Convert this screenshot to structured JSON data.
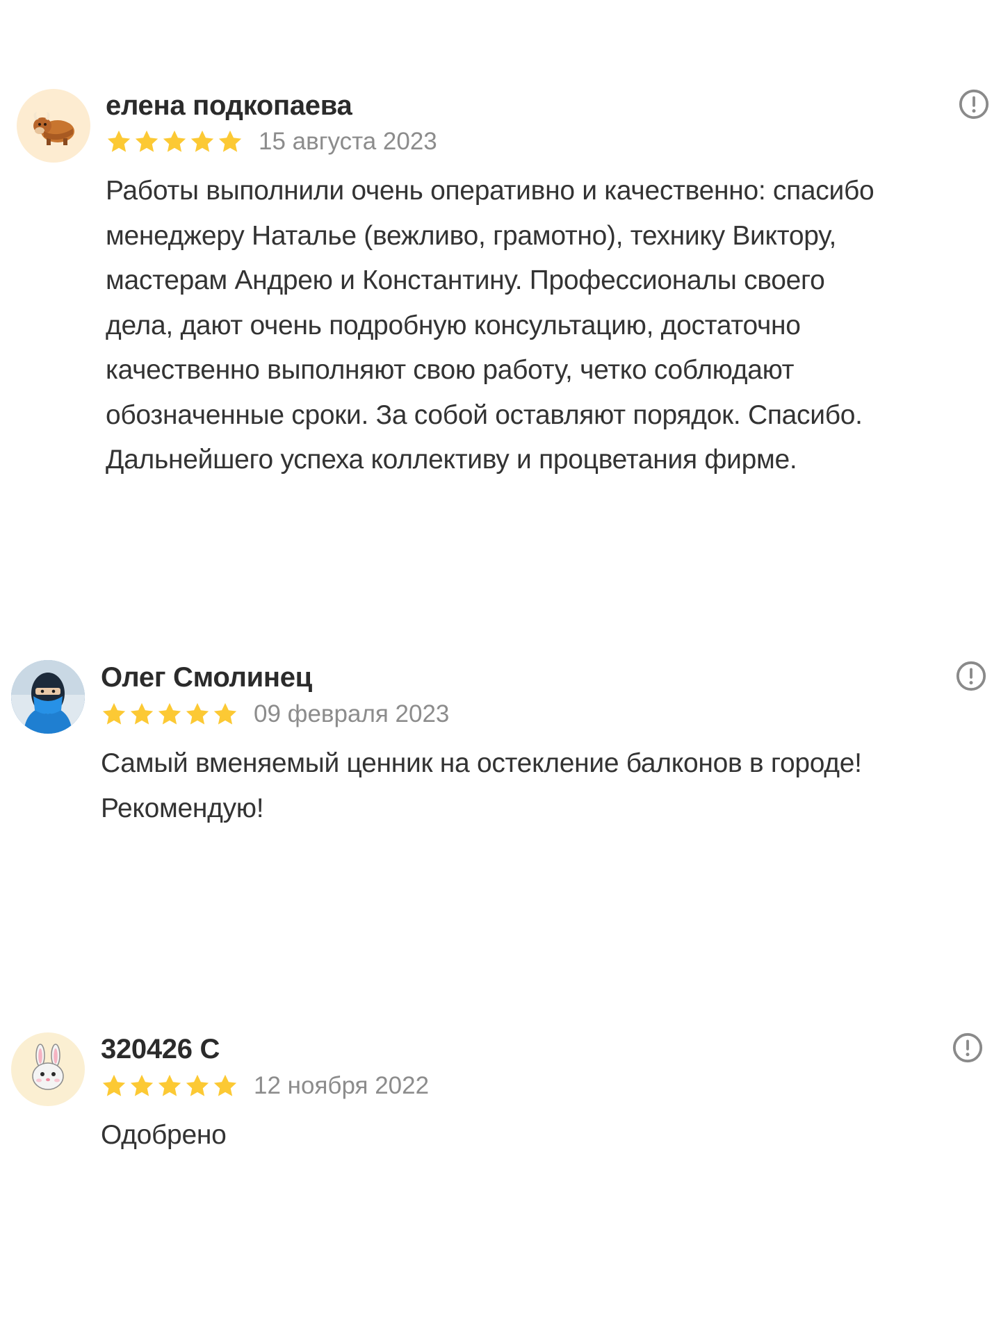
{
  "reviews": [
    {
      "author": "елена подкопаева",
      "rating": 5,
      "date": "15 августа 2023",
      "avatar_icon": "yak-icon",
      "avatar_bg": "#fdecd1",
      "lines": [
        "Работы выполнили очень оперативно и качественно: спасибо",
        "менеджеру Наталье (вежливо, грамотно), технику Виктору,",
        "мастерам Андрею и Константину. Профессионалы своего",
        "дела, дают очень подробную консультацию, достаточно",
        "качественно выполняют свою работу, четко соблюдают",
        "обозначенные сроки. За собой оставляют порядок. Спасибо.",
        "Дальнейшего успеха коллективу и процветания фирме."
      ]
    },
    {
      "author": "Олег Смолинец",
      "rating": 5,
      "date": "09 февраля 2023",
      "avatar_icon": "masked-person-photo-icon",
      "avatar_bg": "#2a6fb0",
      "lines": [
        "Самый вменяемый ценник на остекление балконов в городе!",
        "Рекомендую!"
      ]
    },
    {
      "author": "320426 С",
      "rating": 5,
      "date": "12 ноября 2022",
      "avatar_icon": "bunny-icon",
      "avatar_bg": "#fbefd2",
      "lines": [
        "Одобрено"
      ]
    }
  ],
  "colors": {
    "star": "#fcc934",
    "author": "#2b2b2b",
    "date": "#8c8c8c",
    "text": "#333333",
    "report_icon": "#8a8a8a"
  }
}
